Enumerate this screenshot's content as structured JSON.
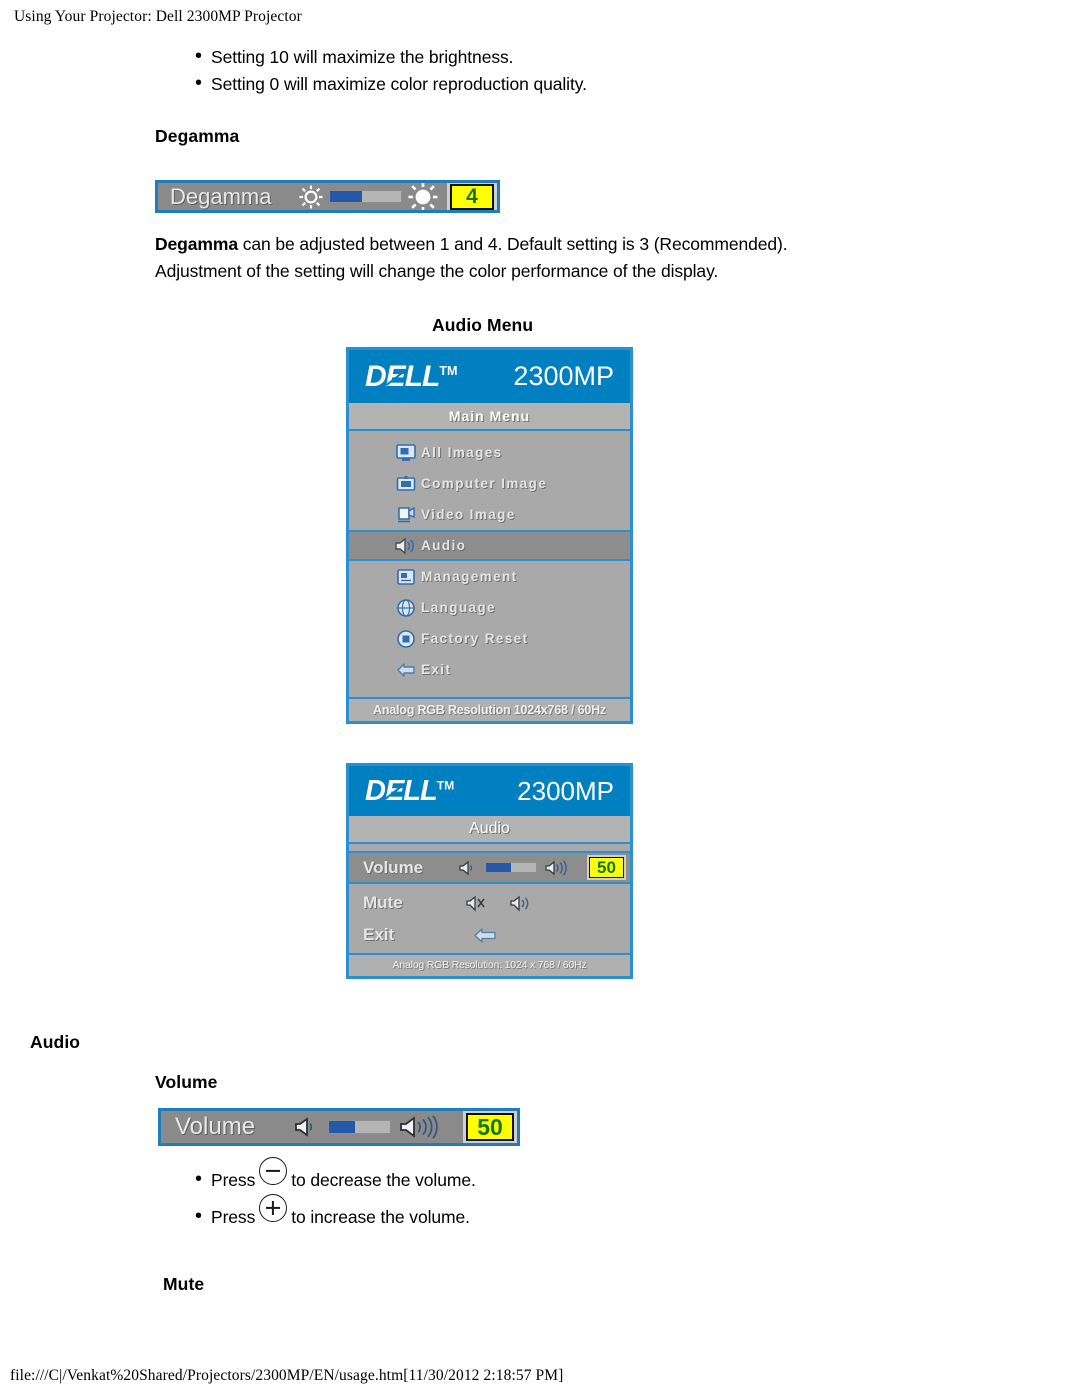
{
  "page": {
    "header": "Using Your Projector: Dell 2300MP Projector",
    "footer": "file:///C|/Venkat%20Shared/Projectors/2300MP/EN/usage.htm[11/30/2012 2:18:57 PM]"
  },
  "colors": {
    "dell_blue": "#0080c0",
    "osd_border_blue": "#2b8fd0",
    "osd_gray": "#a9a9a9",
    "slider_fill_blue": "#2558a8",
    "value_yellow": "#ffff00",
    "value_text_green": "#117711"
  },
  "top_bullets": [
    "Setting 10 will maximize the brightness.",
    "Setting 0 will maximize color reproduction quality."
  ],
  "degamma": {
    "heading": "Degamma",
    "strip": {
      "label": "Degamma",
      "value": "4",
      "fill_percent": 45,
      "left_icon": "brightness-low-icon",
      "right_icon": "brightness-high-icon"
    },
    "paragraph": [
      {
        "bold": "Degamma",
        "rest": " can be adjusted between 1 and 4. Default setting is 3 (Recommended)."
      },
      {
        "bold": "",
        "rest": "Adjustment of the setting will change the color performance of the display."
      }
    ]
  },
  "audio_menu_heading": "Audio Menu",
  "osd_main_menu": {
    "brand": "DELL",
    "trademark": "TM",
    "model": "2300MP",
    "title": "Main Menu",
    "items": [
      {
        "label": "All Images",
        "icon": "all-images-icon",
        "selected": false
      },
      {
        "label": "Computer Image",
        "icon": "computer-image-icon",
        "selected": false
      },
      {
        "label": "Video Image",
        "icon": "video-image-icon",
        "selected": false
      },
      {
        "label": "Audio",
        "icon": "audio-speaker-icon",
        "selected": true
      },
      {
        "label": "Management",
        "icon": "management-icon",
        "selected": false
      },
      {
        "label": "Language",
        "icon": "language-globe-icon",
        "selected": false
      },
      {
        "label": "Factory Reset",
        "icon": "factory-reset-icon",
        "selected": false
      },
      {
        "label": "Exit",
        "icon": "exit-arrow-icon",
        "selected": false
      }
    ],
    "status": "Analog RGB Resolution 1024x768 / 60Hz"
  },
  "osd_audio_menu": {
    "brand": "DELL",
    "trademark": "TM",
    "model": "2300MP",
    "title": "Audio",
    "rows": [
      {
        "label": "Volume",
        "type": "slider",
        "value": "50",
        "fill_percent": 50,
        "left_icon": "speaker-low-icon",
        "right_icon": "speaker-high-icon",
        "selected": true
      },
      {
        "label": "Mute",
        "type": "toggle",
        "left_icon": "speaker-mute-icon",
        "right_icon": "speaker-on-icon",
        "selected": false
      },
      {
        "label": "Exit",
        "type": "action",
        "left_icon": "",
        "right_icon": "exit-arrow-icon",
        "selected": false
      }
    ],
    "status": "Analog RGB Resolution: 1024 x 768 / 60Hz"
  },
  "audio_section": {
    "heading": "Audio",
    "volume_heading": "Volume",
    "strip": {
      "label": "Volume",
      "value": "50",
      "fill_percent": 43,
      "left_icon": "speaker-low-icon",
      "right_icon": "speaker-high-icon"
    },
    "bullets": [
      {
        "pre": "Press ",
        "key": "minus",
        "post": " to decrease the volume."
      },
      {
        "pre": "Press ",
        "key": "plus",
        "post": " to increase the volume."
      }
    ],
    "mute_heading": "Mute"
  }
}
